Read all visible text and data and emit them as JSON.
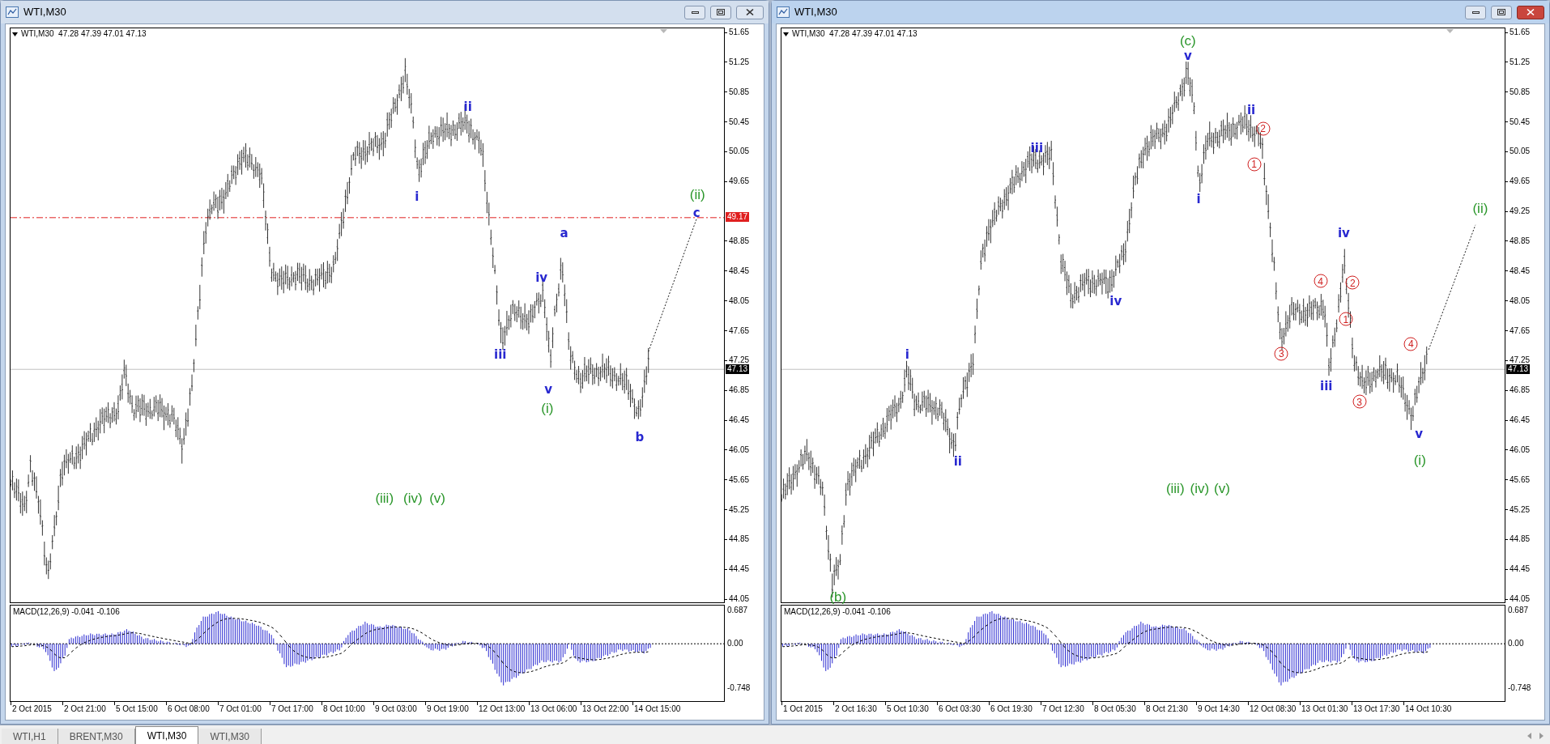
{
  "windows": [
    {
      "title": "WTI,M30",
      "active": false,
      "info": "WTI,M30  47.28 47.39 47.01 47.13",
      "price_axis": [
        "51.65",
        "51.25",
        "50.85",
        "50.45",
        "50.05",
        "49.65",
        "48.85",
        "48.45",
        "48.05",
        "47.65",
        "47.25",
        "46.85",
        "46.45",
        "46.05",
        "45.65",
        "45.25",
        "44.85",
        "44.45",
        "44.05"
      ],
      "current_price": "47.13",
      "level_line": {
        "label": "49.17"
      },
      "macd": {
        "label": "MACD(12,26,9) -0.041 -0.106",
        "axis": [
          "0.687",
          "0.00",
          "-0.748"
        ]
      },
      "time_axis": [
        "2 Oct 2015",
        "2 Oct 21:00",
        "5 Oct 15:00",
        "6 Oct 08:00",
        "7 Oct 01:00",
        "7 Oct 17:00",
        "8 Oct 10:00",
        "9 Oct 03:00",
        "9 Oct 19:00",
        "12 Oct 13:00",
        "13 Oct 06:00",
        "13 Oct 22:00",
        "14 Oct 15:00"
      ],
      "wave_labels": [
        {
          "text": "i",
          "kind": "minor",
          "color": "#2828d0"
        },
        {
          "text": "ii",
          "kind": "minor",
          "color": "#2828d0"
        },
        {
          "text": "iii",
          "kind": "minor",
          "color": "#2828d0"
        },
        {
          "text": "iv",
          "kind": "minor",
          "color": "#2828d0"
        },
        {
          "text": "v",
          "kind": "minor",
          "color": "#2828d0"
        },
        {
          "text": "a",
          "kind": "minor",
          "color": "#2828d0"
        },
        {
          "text": "b",
          "kind": "minor",
          "color": "#2828d0"
        },
        {
          "text": "c",
          "kind": "minor",
          "color": "#2828d0"
        },
        {
          "text": "(i)",
          "kind": "intermediate",
          "color": "#2a962a"
        },
        {
          "text": "(ii)",
          "kind": "intermediate",
          "color": "#2a962a"
        },
        {
          "text": "(iii)",
          "kind": "intermediate",
          "color": "#2a962a"
        },
        {
          "text": "(iv)",
          "kind": "intermediate",
          "color": "#2a962a"
        },
        {
          "text": "(v)",
          "kind": "intermediate",
          "color": "#2a962a"
        }
      ]
    },
    {
      "title": "WTI,M30",
      "active": true,
      "info": "WTI,M30  47.28 47.39 47.01 47.13",
      "price_axis": [
        "51.65",
        "51.25",
        "50.85",
        "50.45",
        "50.05",
        "49.65",
        "49.25",
        "48.85",
        "48.45",
        "48.05",
        "47.65",
        "47.25",
        "46.85",
        "46.45",
        "46.05",
        "45.65",
        "45.25",
        "44.85",
        "44.45",
        "44.05"
      ],
      "current_price": "47.13",
      "macd": {
        "label": "MACD(12,26,9) -0.041 -0.106",
        "axis": [
          "0.687",
          "0.00",
          "-0.748"
        ]
      },
      "time_axis": [
        "1 Oct 2015",
        "2 Oct 16:30",
        "5 Oct 10:30",
        "6 Oct 03:30",
        "6 Oct 19:30",
        "7 Oct 12:30",
        "8 Oct 05:30",
        "8 Oct 21:30",
        "9 Oct 14:30",
        "12 Oct 08:30",
        "13 Oct 01:30",
        "13 Oct 17:30",
        "14 Oct 10:30"
      ],
      "wave_labels": [
        {
          "text": "(c)",
          "kind": "intermediate",
          "color": "#2a962a"
        },
        {
          "text": "v",
          "kind": "minor",
          "color": "#2828d0"
        },
        {
          "text": "ii",
          "kind": "minor",
          "color": "#2828d0"
        },
        {
          "text": "2",
          "kind": "circled",
          "color": "#d02020"
        },
        {
          "text": "1",
          "kind": "circled",
          "color": "#d02020"
        },
        {
          "text": "iii",
          "kind": "minor",
          "color": "#2828d0"
        },
        {
          "text": "i",
          "kind": "minor",
          "color": "#2828d0"
        },
        {
          "text": "iv",
          "kind": "minor",
          "color": "#2828d0"
        },
        {
          "text": "i",
          "kind": "minor",
          "color": "#2828d0"
        },
        {
          "text": "ii",
          "kind": "minor",
          "color": "#2828d0"
        },
        {
          "text": "(b)",
          "kind": "intermediate",
          "color": "#2a962a"
        },
        {
          "text": "4",
          "kind": "circled",
          "color": "#d02020"
        },
        {
          "text": "iv",
          "kind": "minor",
          "color": "#2828d0"
        },
        {
          "text": "2",
          "kind": "circled",
          "color": "#d02020"
        },
        {
          "text": "1",
          "kind": "circled",
          "color": "#d02020"
        },
        {
          "text": "3",
          "kind": "circled",
          "color": "#d02020"
        },
        {
          "text": "iii",
          "kind": "minor",
          "color": "#2828d0"
        },
        {
          "text": "3",
          "kind": "circled",
          "color": "#d02020"
        },
        {
          "text": "4",
          "kind": "circled",
          "color": "#d02020"
        },
        {
          "text": "v",
          "kind": "minor",
          "color": "#2828d0"
        },
        {
          "text": "(i)",
          "kind": "intermediate",
          "color": "#2a962a"
        },
        {
          "text": "(ii)",
          "kind": "intermediate",
          "color": "#2a962a"
        },
        {
          "text": "(iii)",
          "kind": "intermediate",
          "color": "#2a962a"
        },
        {
          "text": "(iv)",
          "kind": "intermediate",
          "color": "#2a962a"
        },
        {
          "text": "(v)",
          "kind": "intermediate",
          "color": "#2a962a"
        }
      ]
    }
  ],
  "tabs": [
    {
      "label": "WTI,H1",
      "selected": false
    },
    {
      "label": "BRENT,M30",
      "selected": false
    },
    {
      "label": "WTI,M30",
      "selected": true
    },
    {
      "label": "WTI,M30",
      "selected": false
    }
  ]
}
